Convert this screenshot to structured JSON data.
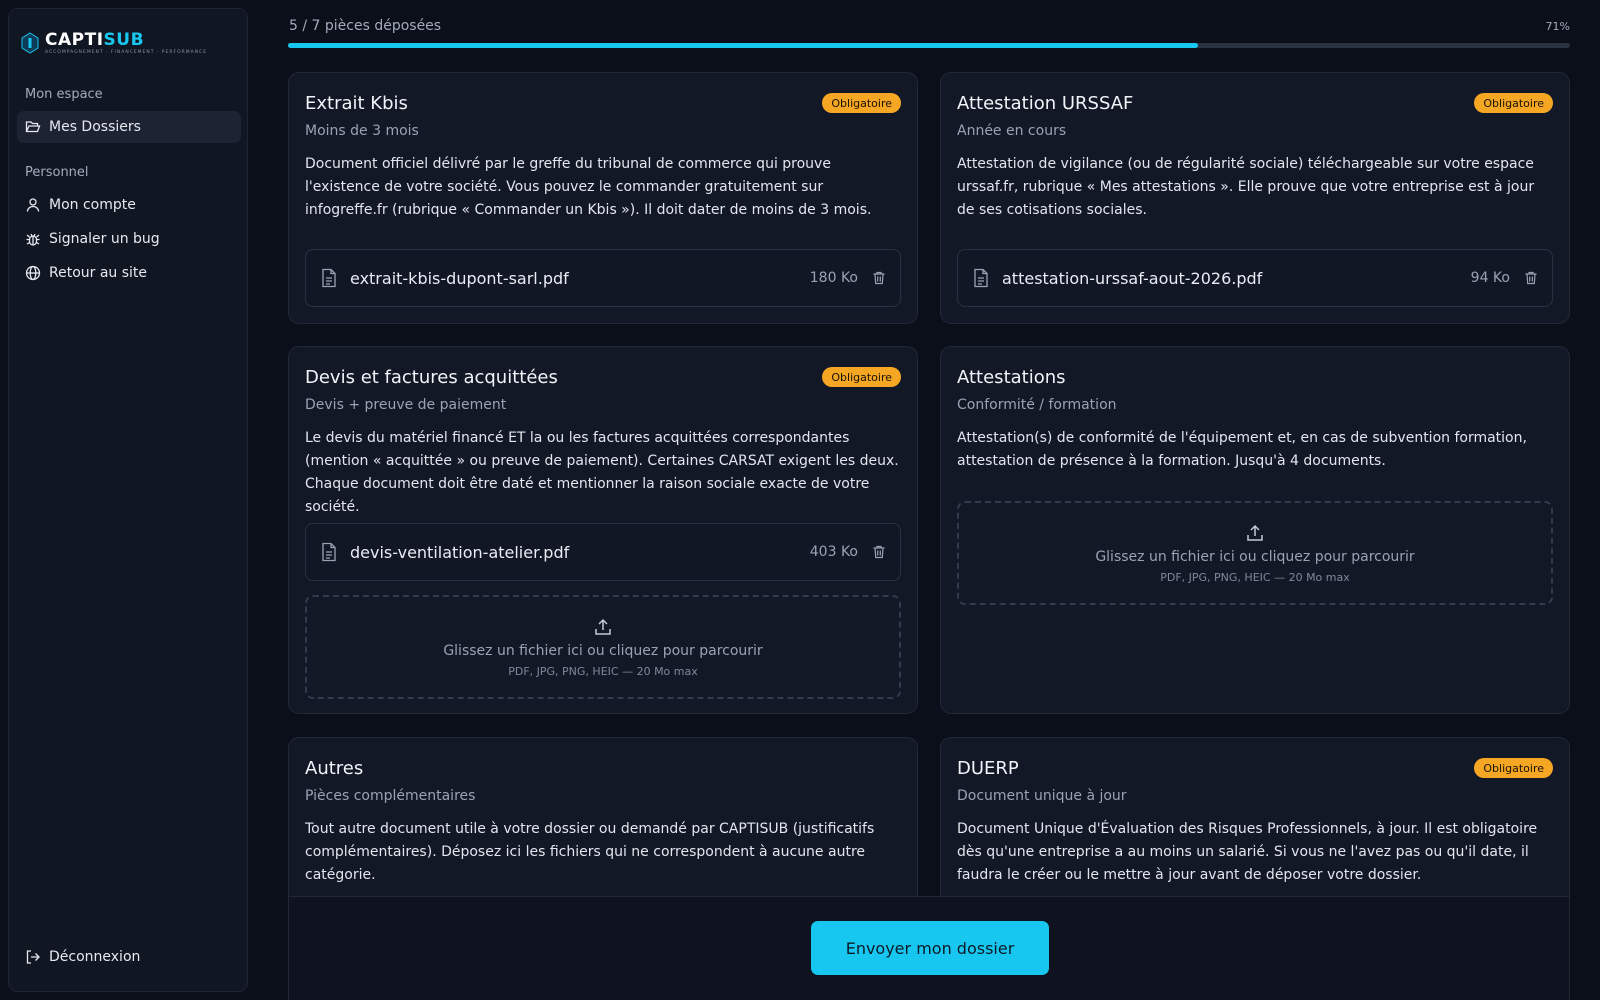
{
  "brand": {
    "name_main": "CAPTI",
    "name_accent": "SUB",
    "tagline": "ACCOMPAGNEMENT · FINANCEMENT · PERFORMANCE",
    "accent_color": "#18c7f0"
  },
  "sidebar": {
    "section_space": "Mon espace",
    "section_personal": "Personnel",
    "items": [
      {
        "label": "Mes Dossiers",
        "icon": "folder-open-icon",
        "active": true
      },
      {
        "label": "Mon compte",
        "icon": "user-icon"
      },
      {
        "label": "Signaler un bug",
        "icon": "bug-icon"
      },
      {
        "label": "Retour au site",
        "icon": "globe-icon"
      }
    ],
    "logout": {
      "label": "Déconnexion",
      "icon": "logout-icon"
    }
  },
  "progress": {
    "label": "5 / 7 pièces déposées",
    "percent_label": "71%",
    "fraction": 0.71,
    "color": "#18c7f0"
  },
  "cards": [
    {
      "title": "Extrait Kbis",
      "badge": "Obligatoire",
      "subtitle": "Moins de 3 mois",
      "description": "Document officiel délivré par le greffe du tribunal de commerce qui prouve l'existence de votre société. Vous pouvez le commander gratuitement sur infogreffe.fr (rubrique « Commander un Kbis »). Il doit dater de moins de 3 mois.",
      "file": {
        "name": "extrait-kbis-dupont-sarl.pdf",
        "size": "180 Ko"
      }
    },
    {
      "title": "Attestation URSSAF",
      "badge": "Obligatoire",
      "subtitle": "Année en cours",
      "description": "Attestation de vigilance (ou de régularité sociale) téléchargeable sur votre espace urssaf.fr, rubrique « Mes attestations ». Elle prouve que votre entreprise est à jour de ses cotisations sociales.",
      "file": {
        "name": "attestation-urssaf-aout-2026.pdf",
        "size": "94 Ko"
      }
    },
    {
      "title": "Devis et factures acquittées",
      "badge": "Obligatoire",
      "subtitle": "Devis + preuve de paiement",
      "description": "Le devis du matériel financé ET la ou les factures acquittées correspondantes (mention « acquittée » ou preuve de paiement). Certaines CARSAT exigent les deux. Chaque document doit être daté et mentionner la raison sociale exacte de votre société.",
      "file": {
        "name": "devis-ventilation-atelier.pdf",
        "size": "403 Ko"
      }
    },
    {
      "title": "Attestations",
      "subtitle": "Conformité / formation",
      "description": "Attestation(s) de conformité de l'équipement et, en cas de subvention formation, attestation de présence à la formation. Jusqu'à 4 documents."
    },
    {
      "title": "Autres",
      "subtitle": "Pièces complémentaires",
      "description": "Tout autre document utile à votre dossier ou demandé par CAPTISUB (justificatifs complémentaires). Déposez ici les fichiers qui ne correspondent à aucune autre catégorie."
    },
    {
      "title": "DUERP",
      "badge": "Obligatoire",
      "subtitle": "Document unique à jour",
      "description": "Document Unique d'Évaluation des Risques Professionnels, à jour. Il est obligatoire dès qu'une entreprise a au moins un salarié. Si vous ne l'avez pas ou qu'il date, il faudra le créer ou le mettre à jour avant de déposer votre dossier."
    }
  ],
  "dropzone": {
    "text": "Glissez un fichier ici ou cliquez pour parcourir",
    "hint": "PDF, JPG, PNG, HEIC — 20 Mo max"
  },
  "actions": {
    "send_label": "Envoyer mon dossier"
  },
  "colors": {
    "badge": "#f5a623",
    "background": "#0b0f1a",
    "card": "#131826"
  }
}
